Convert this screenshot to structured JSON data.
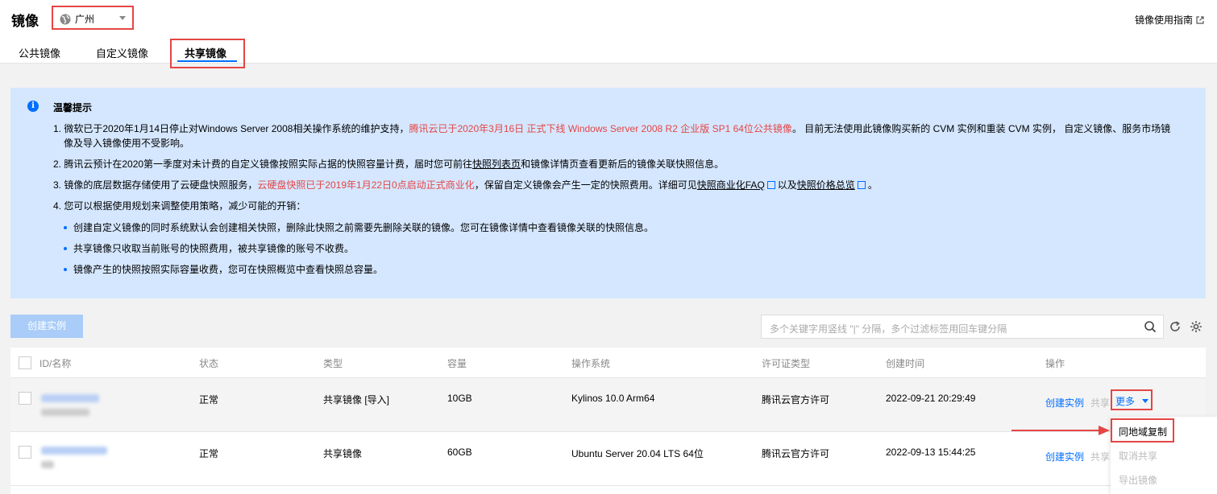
{
  "header": {
    "title": "镜像",
    "region": "广州",
    "guide_link": "镜像使用指南"
  },
  "tabs": [
    {
      "label": "公共镜像",
      "active": false
    },
    {
      "label": "自定义镜像",
      "active": false
    },
    {
      "label": "共享镜像",
      "active": true
    }
  ],
  "notice": {
    "title": "温馨提示",
    "item1": {
      "a": "1. 微软已于2020年1月14日停止对Windows Server 2008相关操作系统的维护支持，",
      "b": "腾讯云已于2020年3月16日 正式下线 Windows Server 2008 R2 企业版 SP1 64位公共镜像",
      "c": "。 目前无法使用此镜像购买新的 CVM 实例和重装 CVM 实例， 自定义镜像、服务市场镜",
      "d": "像及导入镜像使用不受影响。"
    },
    "item2": {
      "a": "2. 腾讯云预计在2020第一季度对未计费的自定义镜像按照实际占据的快照容量计费，届时您可前往",
      "b": "快照列表页",
      "c": "和镜像详情页查看更新后的镜像关联快照信息。"
    },
    "item3": {
      "a": "3. 镜像的底层数据存储使用了云硬盘快照服务，",
      "b": "云硬盘快照已于2019年1月22日0点启动正式商业化",
      "c": "，保留自定义镜像会产生一定的快照费用。详细可见",
      "d": "快照商业化FAQ",
      "e": "以及",
      "f": "快照价格总览",
      "g": "。"
    },
    "item4": "4. 您可以根据使用规划来调整使用策略，减少可能的开销：",
    "bullets": [
      "创建自定义镜像的同时系统默认会创建相关快照，删除此快照之前需要先删除关联的镜像。您可在镜像详情中查看镜像关联的快照信息。",
      "共享镜像只收取当前账号的快照费用，被共享镜像的账号不收费。",
      "镜像产生的快照按照实际容量收费，您可在快照概览中查看快照总容量。"
    ]
  },
  "toolbar": {
    "create_button": "创建实例",
    "search_placeholder": "多个关键字用竖线 \"|\" 分隔，多个过滤标签用回车键分隔"
  },
  "table": {
    "headers": [
      "ID/名称",
      "状态",
      "类型",
      "容量",
      "操作系统",
      "许可证类型",
      "创建时间",
      "操作"
    ],
    "rows": [
      {
        "status": "正常",
        "type": "共享镜像 [导入]",
        "size": "10GB",
        "os": "Kylinos 10.0 Arm64",
        "license": "腾讯云官方许可",
        "created": "2022-09-21 20:29:49",
        "action_create": "创建实例",
        "action_share": "共享",
        "action_more": "更多"
      },
      {
        "status": "正常",
        "type": "共享镜像",
        "size": "60GB",
        "os": "Ubuntu Server 20.04 LTS 64位",
        "license": "腾讯云官方许可",
        "created": "2022-09-13 15:44:25",
        "action_create": "创建实例",
        "action_share": "共享"
      }
    ]
  },
  "dropdown": {
    "items": [
      "同地域复制",
      "取消共享",
      "导出镜像"
    ]
  },
  "colors": {
    "accent": "#006eff",
    "highlight": "#e54545",
    "notice_bg": "#d5e7ff"
  }
}
